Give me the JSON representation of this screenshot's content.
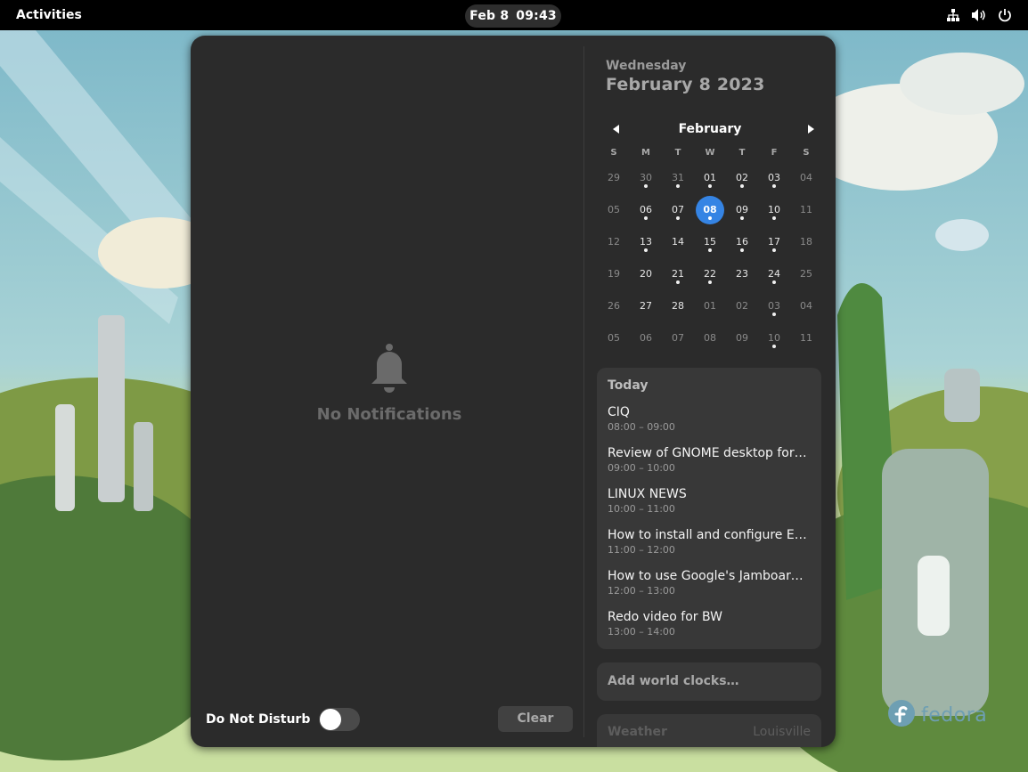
{
  "topbar": {
    "activities": "Activities",
    "date": "Feb 8",
    "time": "09:43",
    "icons": [
      "network-icon",
      "volume-icon",
      "power-icon"
    ]
  },
  "notifications": {
    "icon": "bell-icon",
    "empty_label": "No Notifications",
    "dnd_label": "Do Not Disturb",
    "dnd_enabled": false,
    "clear_label": "Clear"
  },
  "calendar": {
    "weekday": "Wednesday",
    "full_date": "February 8 2023",
    "month": "February",
    "accent_color": "#3584e4",
    "day_headers": [
      "S",
      "M",
      "T",
      "W",
      "T",
      "F",
      "S"
    ],
    "weeks": [
      [
        {
          "d": "29",
          "other": true
        },
        {
          "d": "30",
          "other": true,
          "ev": true
        },
        {
          "d": "31",
          "other": true,
          "ev": true
        },
        {
          "d": "01",
          "ev": true
        },
        {
          "d": "02",
          "ev": true
        },
        {
          "d": "03",
          "ev": true
        },
        {
          "d": "04"
        }
      ],
      [
        {
          "d": "05"
        },
        {
          "d": "06",
          "ev": true
        },
        {
          "d": "07",
          "ev": true
        },
        {
          "d": "08",
          "today": true,
          "ev": true
        },
        {
          "d": "09",
          "ev": true
        },
        {
          "d": "10",
          "ev": true
        },
        {
          "d": "11"
        }
      ],
      [
        {
          "d": "12"
        },
        {
          "d": "13",
          "ev": true
        },
        {
          "d": "14"
        },
        {
          "d": "15",
          "ev": true
        },
        {
          "d": "16",
          "ev": true
        },
        {
          "d": "17",
          "ev": true
        },
        {
          "d": "18"
        }
      ],
      [
        {
          "d": "19"
        },
        {
          "d": "20"
        },
        {
          "d": "21",
          "ev": true
        },
        {
          "d": "22",
          "ev": true
        },
        {
          "d": "23"
        },
        {
          "d": "24",
          "ev": true
        },
        {
          "d": "25"
        }
      ],
      [
        {
          "d": "26"
        },
        {
          "d": "27"
        },
        {
          "d": "28"
        },
        {
          "d": "01",
          "other": true
        },
        {
          "d": "02",
          "other": true
        },
        {
          "d": "03",
          "other": true,
          "ev": true
        },
        {
          "d": "04",
          "other": true
        }
      ],
      [
        {
          "d": "05",
          "other": true
        },
        {
          "d": "06",
          "other": true
        },
        {
          "d": "07",
          "other": true
        },
        {
          "d": "08",
          "other": true
        },
        {
          "d": "09",
          "other": true
        },
        {
          "d": "10",
          "other": true,
          "ev": true
        },
        {
          "d": "11",
          "other": true
        }
      ]
    ]
  },
  "events": {
    "heading": "Today",
    "items": [
      {
        "title": "CIQ",
        "time": "08:00 – 09:00"
      },
      {
        "title": "Review of GNOME desktop for F…",
        "time": "09:00 – 10:00"
      },
      {
        "title": "LINUX NEWS",
        "time": "10:00 – 11:00"
      },
      {
        "title": "How to install and configure Eas…",
        "time": "11:00 – 12:00"
      },
      {
        "title": "How to use Google's Jamboard …",
        "time": "12:00 – 13:00"
      },
      {
        "title": "Redo video for BW",
        "time": "13:00 – 14:00"
      }
    ]
  },
  "world_clocks": {
    "label": "Add world clocks…"
  },
  "weather": {
    "label": "Weather",
    "location": "Louisville"
  },
  "branding": {
    "logo_text": "fedora"
  }
}
